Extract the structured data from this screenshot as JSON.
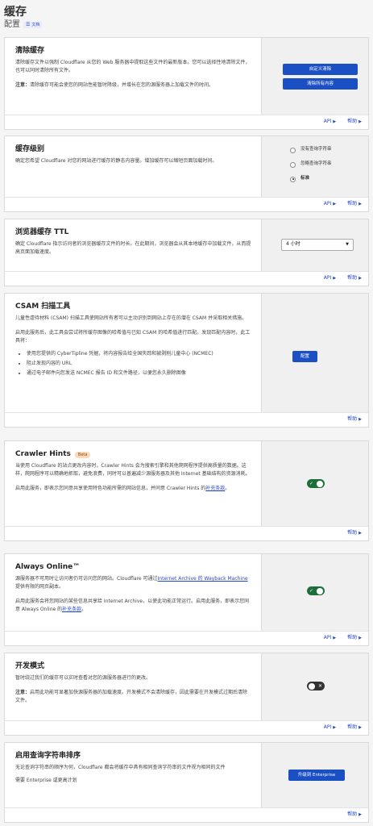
{
  "header": {
    "title": "缓存",
    "subtitle": "配置",
    "docs_badge": "文档"
  },
  "footer_links": {
    "api": "API",
    "help": "帮助"
  },
  "purge": {
    "title": "清除缓存",
    "desc": "清除缓存文件以强制 Cloudflare 从您的 Web 服务器中提取这些文件的最新版本。您可以选择性地清除文件，也可以同时清除所有文件。",
    "note_label": "注意：",
    "note": "清除缓存可能会使您的网站性能暂时降级，并增长在您的源服务器上加载文件的时间。",
    "btn_custom": "自定义清除",
    "btn_all": "清除所有内容"
  },
  "cache_level": {
    "title": "缓存级别",
    "desc": "确定您希望 Cloudflare 对您的网站进行缓存的静态内容量。增加缓存可以缩短页面加载时间。",
    "options": [
      "没有查询字符串",
      "忽略查询字符串",
      "标准"
    ],
    "selected": "标准"
  },
  "browser_ttl": {
    "title": "浏览器缓存 TTL",
    "desc": "确定 Cloudflare 指示访问者的浏览器缓存文件的时长。在此期间，浏览器会从其本地缓存中加载文件，从而提高页面加载速度。",
    "value": "4 小时"
  },
  "csam": {
    "title": "CSAM 扫描工具",
    "desc1": "儿童性虐待材料 (CSAM) 扫描工具使网站所有者可以主动识别到网站上存在的潜在 CSAM 并采取相关措施。",
    "desc2": "启用此服务后，此工具会尝试将所缓存图像的哈希值与已知 CSAM 的哈希值进行匹配。发现匹配内容时，此工具将：",
    "bullets": [
      "使用您提供的 CyberTipline 凭据，将内容报告给全国失踪和被剥削儿童中心 (NCMEC)",
      "阻止发现内容的 URL",
      "通过电子邮件向您发送 NCMEC 报告 ID 和文件路径，以便您永久删除图像"
    ],
    "btn": "配置"
  },
  "crawler": {
    "title": "Crawler Hints",
    "badge": "Beta",
    "desc1": "当使用 Cloudflare 的站点更改内容时，Crawler Hints 会为搜索引擎和其他爬网程序提供高质量的数据。这样，爬网程序可以精确地抓取，避免浪费，同时可以普遍减少源服务器及其他 Internet 基础结构的资源消耗。",
    "desc2_pre": "启用此服务，即表示您同意共享使用特色功能所需的网站信息，并同意 Crawler Hints 的",
    "desc2_link": "补充条款",
    "desc2_post": "。",
    "enabled": true
  },
  "always_online": {
    "title": "Always Online™",
    "desc1_pre": "源服务器不可用时让访问者仍可访问您的网站。Cloudflare 可通过",
    "desc1_link": "Internet Archive 的 Wayback Machine",
    "desc1_post": "提供有限的网页副本。",
    "desc2_pre": "启用此服务会将您网站的某些信息共享给 Internet Archive，以使此功能正常运行。启用此服务，即表示您同意 Always Online 的",
    "desc2_link": "补充条款",
    "desc2_post": "。",
    "enabled": true
  },
  "dev_mode": {
    "title": "开发模式",
    "desc": "暂时绕过我们的缓存可以实时查看对您的源服务器进行的更改。",
    "note_label": "注意：",
    "note": "启用此功能可显著加快源服务器的加载速度。开发模式不会清除缓存，因此需要在开发模式过期后清除文件。",
    "enabled": false
  },
  "query_sort": {
    "title": "启用查询字符串排序",
    "desc": "无论查询字符串的顺序为何，Cloudflare 都会将缓存中具有相同查询字符串的文件视为相同的文件",
    "req": "需要 Enterprise 或更高计划",
    "btn": "升级到 Enterprise"
  },
  "colors": {
    "accent": "#1b4fc4",
    "toggle_on": "#1c6e3a",
    "link": "#2447c5"
  }
}
